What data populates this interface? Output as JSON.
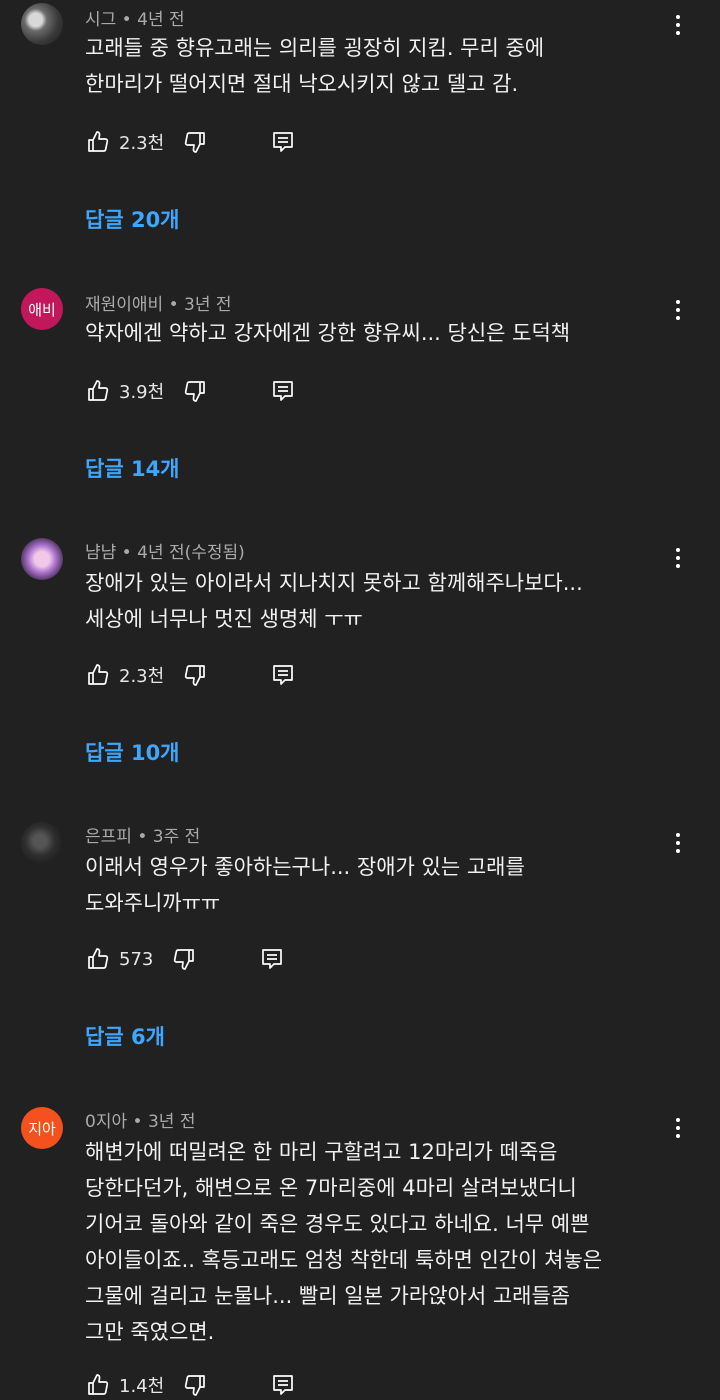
{
  "comments": [
    {
      "author": "시그",
      "time": "4년 전",
      "avatar_text": "",
      "lines": [
        "고래들 중 향유고래는 의리를 굉장히 지킴. 무리 중에",
        "한마리가 떨어지면 절대 낙오시키지 않고 델고 감."
      ],
      "likes": "2.3천",
      "replies": "답글 20개"
    },
    {
      "author": "재원이애비",
      "time": "3년 전",
      "avatar_text": "애비",
      "avatar_color": "#c2185b",
      "lines": [
        "약자에겐 약하고 강자에겐 강한 향유씨... 당신은 도덕책"
      ],
      "likes": "3.9천",
      "replies": "답글 14개"
    },
    {
      "author": "냠냠",
      "time": "4년 전(수정됨)",
      "avatar_text": "",
      "lines": [
        "장애가 있는 아이라서 지나치지 못하고 함께해주나보다...",
        "세상에 너무나 멋진 생명체 ㅜㅠ"
      ],
      "likes": "2.3천",
      "replies": "답글 10개"
    },
    {
      "author": "은프피",
      "time": "3주 전",
      "avatar_text": "",
      "lines": [
        "이래서 영우가 좋아하는구나... 장애가 있는 고래를",
        "도와주니까ㅠㅠ"
      ],
      "likes": "573",
      "replies": "답글 6개"
    },
    {
      "author": "0지아",
      "time": "3년 전",
      "avatar_text": "지아",
      "avatar_color": "#f4511e",
      "lines": [
        "해변가에 떠밀려온 한 마리 구할려고 12마리가 떼죽음",
        "당한다던가, 해변으로 온 7마리중에 4마리 살려보냈더니",
        "기어코 돌아와 같이 죽은 경우도 있다고 하네요. 너무 예쁜",
        "아이들이죠.. 혹등고래도 엄청 착한데 툭하면 인간이 쳐놓은",
        "그물에 걸리고 눈물나... 빨리 일본 가라앉아서 고래들좀",
        "그만 죽였으면."
      ],
      "likes": "1.4천",
      "replies": ""
    }
  ],
  "separator": " • ",
  "icons": {
    "like": "thumbs-up-icon",
    "dislike": "thumbs-down-icon",
    "reply": "reply-comment-icon",
    "more": "more-vertical-icon"
  }
}
